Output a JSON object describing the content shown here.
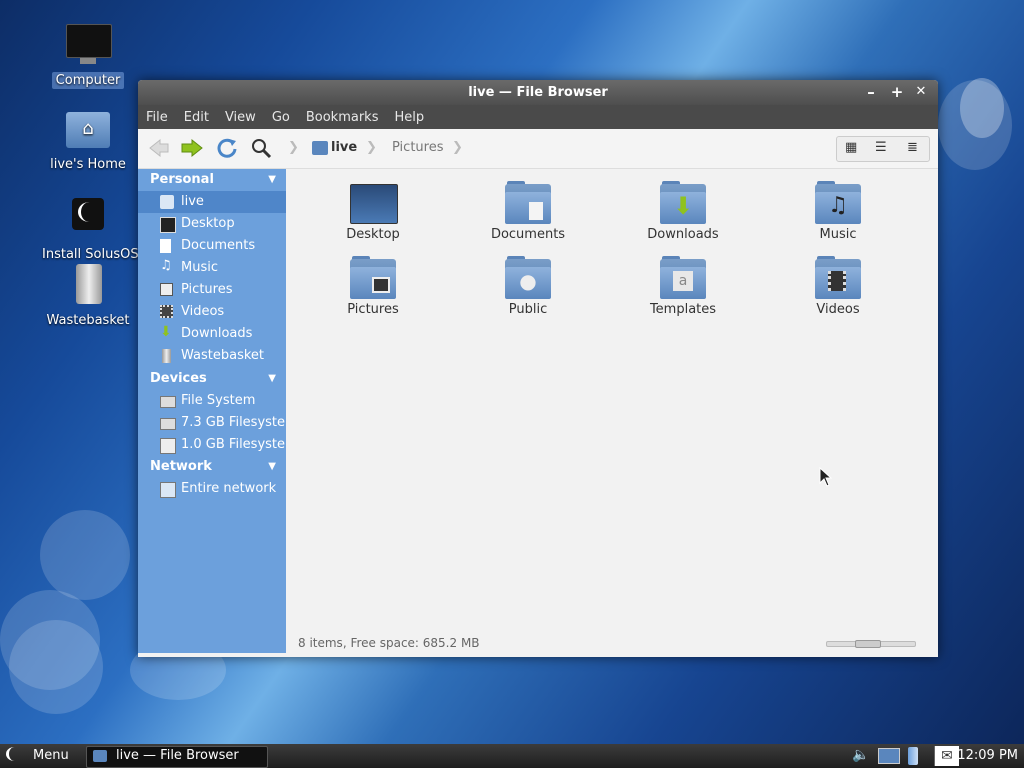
{
  "desktop": {
    "icons": [
      {
        "label": "Computer"
      },
      {
        "label": "live's Home"
      },
      {
        "label": "Install SolusOS"
      },
      {
        "label": "Wastebasket"
      }
    ]
  },
  "window": {
    "title": "live — File Browser",
    "controls": {
      "minimize": "–",
      "maximize": "+",
      "close": "✕"
    },
    "menu": [
      "File",
      "Edit",
      "View",
      "Go",
      "Bookmarks",
      "Help"
    ],
    "breadcrumb": {
      "current": "live",
      "next": "Pictures"
    },
    "sidebar": {
      "personal": {
        "title": "Personal",
        "items": [
          "live",
          "Desktop",
          "Documents",
          "Music",
          "Pictures",
          "Videos",
          "Downloads",
          "Wastebasket"
        ]
      },
      "devices": {
        "title": "Devices",
        "items": [
          "File System",
          "7.3 GB Filesyste...",
          "1.0 GB Filesyste..."
        ]
      },
      "network": {
        "title": "Network",
        "items": [
          "Entire network"
        ]
      }
    },
    "files": [
      "Desktop",
      "Documents",
      "Downloads",
      "Music",
      "Pictures",
      "Public",
      "Templates",
      "Videos"
    ],
    "status": "8 items, Free space: 685.2 MB"
  },
  "taskbar": {
    "menu_label": "Menu",
    "task_label": "live — File Browser",
    "clock": "12:09 PM"
  },
  "colors": {
    "sidebar": "#6ca0dc",
    "sidebar_active": "#4f86c9",
    "titlebar": "#4e4e4e"
  }
}
